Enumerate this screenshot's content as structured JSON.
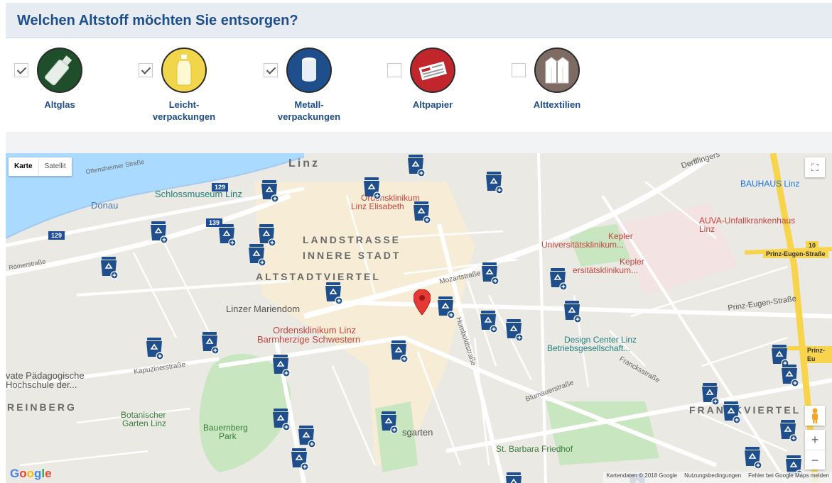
{
  "header": {
    "title": "Welchen Altstoff möchten Sie entsorgen?"
  },
  "filters": [
    {
      "key": "altglas",
      "label_line1": "Altglas",
      "label_line2": "",
      "checked": true,
      "color": "#1f4f2a",
      "icon": "bottle-icon"
    },
    {
      "key": "leicht",
      "label_line1": "Leicht-",
      "label_line2": "verpackungen",
      "checked": true,
      "color": "#f1d54a",
      "icon": "plastic-bottle-icon"
    },
    {
      "key": "metall",
      "label_line1": "Metall-",
      "label_line2": "verpackungen",
      "checked": true,
      "color": "#1f4e8c",
      "icon": "can-icon"
    },
    {
      "key": "altpapier",
      "label_line1": "Altpapier",
      "label_line2": "",
      "checked": false,
      "color": "#c0262c",
      "icon": "newspaper-icon"
    },
    {
      "key": "alttextilien",
      "label_line1": "Alttextilien",
      "label_line2": "",
      "checked": false,
      "color": "#7d6b64",
      "icon": "jacket-icon"
    }
  ],
  "map": {
    "map_type": {
      "map": "Karte",
      "satellite": "Satellit"
    },
    "labels": {
      "linz": "Linz",
      "donau": "Donau",
      "landstrasse": "LANDSTRASSE",
      "innere_stadt": "INNERE STADT",
      "altstadtviertel": "ALTSTADTVIERTEL",
      "reinberg": "REINBERG",
      "frankviertel": "FRANCKVIERTEL",
      "schlossmuseum": "Schlossmuseum Linz",
      "ordensklinikum_elisabeth_1": "Ordensklinikum",
      "ordensklinikum_elisabeth_2": "Linz Elisabeth",
      "kepler_1": "Kepler",
      "kepler_1b": "Universitätsklinikum...",
      "kepler_2": "Kepler",
      "kepler_2b": "ersitätsklinikum...",
      "auva_1": "AUVA-Unfallkrankenhaus",
      "auva_2": "Linz",
      "bauhaus": "BAUHAUS Linz",
      "mariendom": "Linzer Mariendom",
      "ordensklinikum_barm_1": "Ordensklinikum Linz",
      "ordensklinikum_barm_2": "Barmherzige Schwestern",
      "design_center_1": "Design Center Linz",
      "design_center_2": "Betriebsgesellschaft...",
      "paedagogische_1": "vate Pädagogische",
      "paedagogische_2": "Hochschule der...",
      "botanischer_1": "Botanischer",
      "botanischer_2": "Garten Linz",
      "bauernberg_1": "Bauernberg",
      "bauernberg_2": "Park",
      "st_barbara": "St. Barbara Friedhof",
      "volksgarten": "sgarten",
      "derfflinger": "Derfflingers",
      "route_129a": "129",
      "route_129b": "129",
      "route_139": "139",
      "route_10": "10",
      "prinz_eugen_yellow": "Prinz-Eugen-Straße",
      "prinz_eugen_yellow2": "Prinz-Eu",
      "prinz_eugen": "Prinz-Eugen-Straße",
      "mozartstr": "Mozartstraße",
      "humboldt": "Humboldtstraße",
      "blumauer": "Blumauerstraße",
      "francks": "Francksstraße",
      "kapuziner": "Kapuzinerstraße",
      "roemer": "Römerstraße",
      "ottensheimer": "Ottensheimer Straße"
    },
    "zoom_in": "+",
    "zoom_out": "−",
    "fullscreen": "⛶",
    "google": "Google",
    "attribution": {
      "data": "Kartendaten © 2018 Google",
      "terms": "Nutzungsbedingungen",
      "report": "Fehler bei Google Maps melden"
    },
    "colors": {
      "marker_blue": "#1f4e8c",
      "pin_red": "#e53935"
    }
  }
}
